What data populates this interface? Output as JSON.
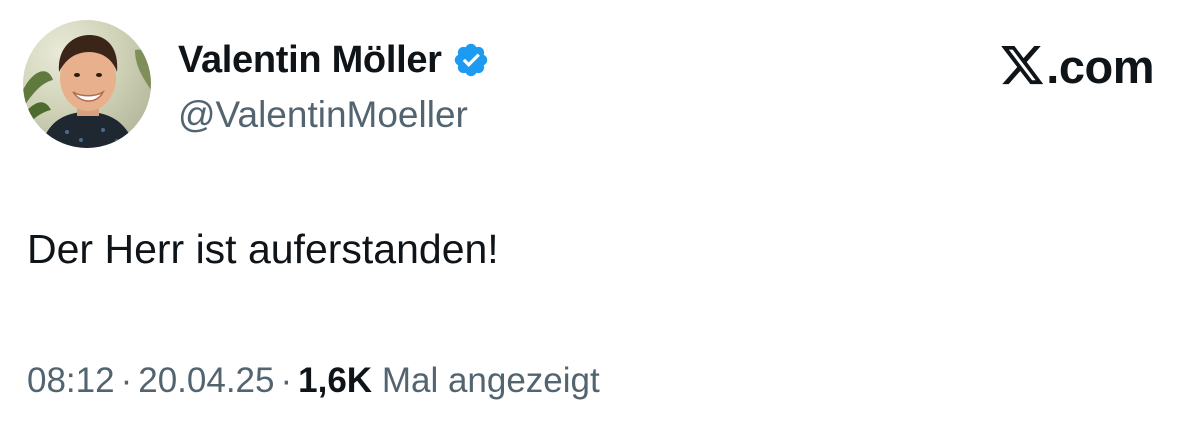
{
  "tweet": {
    "author": {
      "display_name": "Valentin Möller",
      "handle": "@ValentinMoeller",
      "verified": true,
      "avatar_icon": "profile-photo"
    },
    "text": "Der Herr ist auferstanden!",
    "time": "08:12",
    "date": "20.04.25",
    "separator": "·",
    "views_count": "1,6K",
    "views_label": "Mal angezeigt"
  },
  "brand": {
    "icon": "x-logo-icon",
    "label": ".com"
  },
  "colors": {
    "text_primary": "#0f1419",
    "text_secondary": "#536471",
    "verified_blue": "#1d9bf0",
    "background": "#ffffff"
  }
}
